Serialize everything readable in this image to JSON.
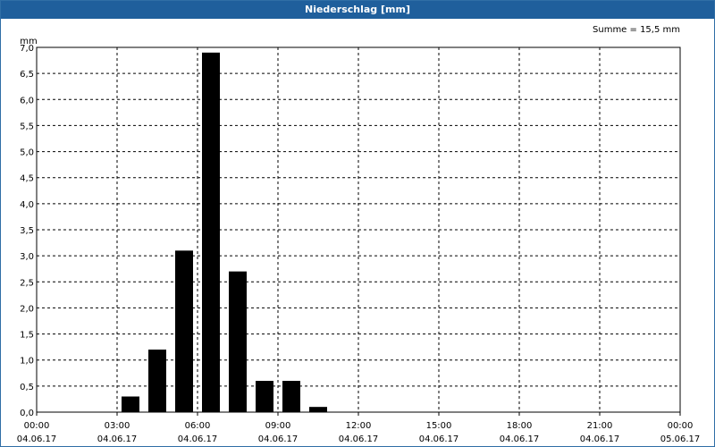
{
  "window": {
    "title": "Niederschlag [mm]"
  },
  "chart_data": {
    "type": "bar",
    "title": "Niederschlag [mm]",
    "unit_label": "mm",
    "sum_label": "Summe = 15,5 mm",
    "ylim": [
      0,
      7.0
    ],
    "y_ticks": [
      "0,0",
      "0,5",
      "1,0",
      "1,5",
      "2,0",
      "2,5",
      "3,0",
      "3,5",
      "4,0",
      "4,5",
      "5,0",
      "5,5",
      "6,0",
      "6,5",
      "7,0"
    ],
    "x_ticks": [
      {
        "time": "00:00",
        "date": "04.06.17"
      },
      {
        "time": "03:00",
        "date": "04.06.17"
      },
      {
        "time": "06:00",
        "date": "04.06.17"
      },
      {
        "time": "09:00",
        "date": "04.06.17"
      },
      {
        "time": "12:00",
        "date": "04.06.17"
      },
      {
        "time": "15:00",
        "date": "04.06.17"
      },
      {
        "time": "18:00",
        "date": "04.06.17"
      },
      {
        "time": "21:00",
        "date": "04.06.17"
      },
      {
        "time": "00:00",
        "date": "05.06.17"
      }
    ],
    "x_hours": [
      0,
      24
    ],
    "bars": [
      {
        "hour": 3,
        "value": 0.3
      },
      {
        "hour": 4,
        "value": 1.2
      },
      {
        "hour": 5,
        "value": 3.1
      },
      {
        "hour": 6,
        "value": 6.9
      },
      {
        "hour": 7,
        "value": 2.7
      },
      {
        "hour": 8,
        "value": 0.6
      },
      {
        "hour": 9,
        "value": 0.6
      },
      {
        "hour": 10,
        "value": 0.1
      }
    ],
    "grid": true,
    "colors": {
      "bar": "#000000",
      "titlebar": "#1f5f9c",
      "grid": "#000000"
    }
  }
}
